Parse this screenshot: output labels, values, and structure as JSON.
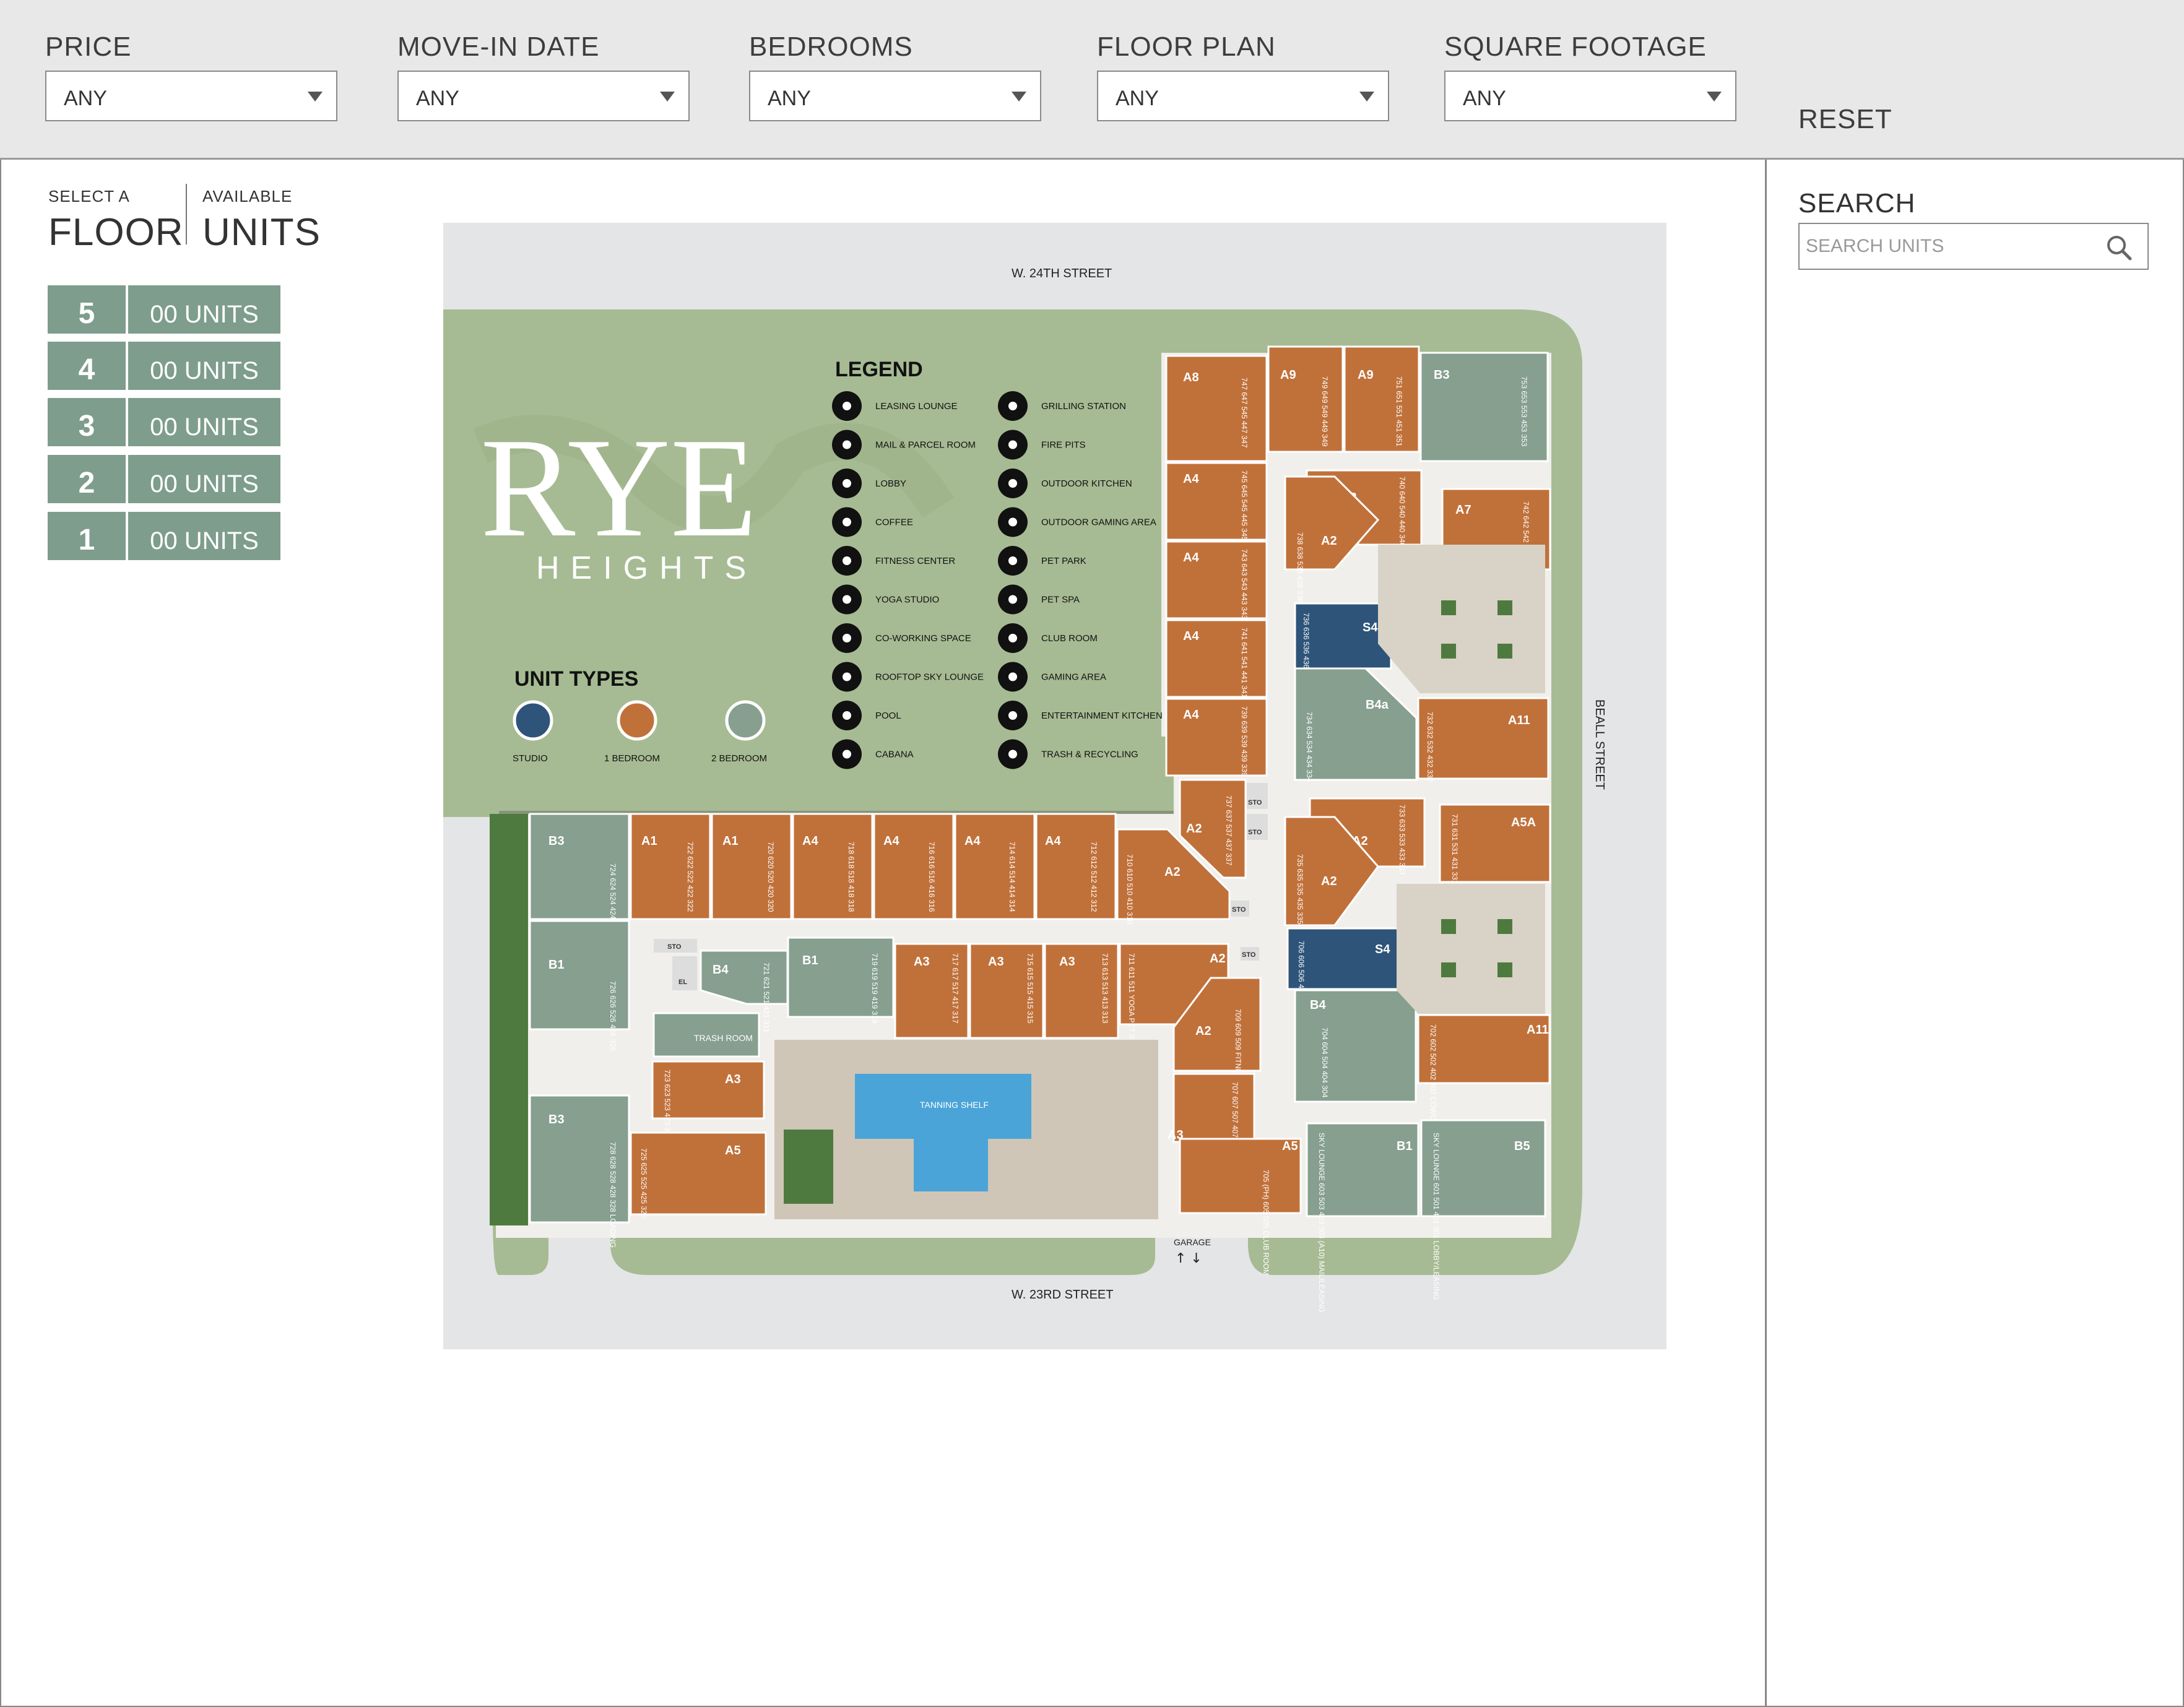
{
  "filters": [
    {
      "label": "PRICE",
      "value": "ANY"
    },
    {
      "label": "MOVE-IN DATE",
      "value": "ANY"
    },
    {
      "label": "BEDROOMS",
      "value": "ANY"
    },
    {
      "label": "FLOOR PLAN",
      "value": "ANY"
    },
    {
      "label": "SQUARE FOOTAGE",
      "value": "ANY"
    }
  ],
  "reset_label": "RESET",
  "floor_panel": {
    "select_a": "SELECT A",
    "floor": "FLOOR",
    "available": "AVAILABLE",
    "units": "UNITS",
    "floors": [
      {
        "number": "5",
        "units": "00 UNITS"
      },
      {
        "number": "4",
        "units": "00 UNITS"
      },
      {
        "number": "3",
        "units": "00 UNITS"
      },
      {
        "number": "2",
        "units": "00 UNITS"
      },
      {
        "number": "1",
        "units": "00 UNITS"
      }
    ]
  },
  "search": {
    "label": "SEARCH",
    "placeholder": "SEARCH UNITS"
  },
  "map": {
    "streets": {
      "north": "W. 24TH STREET",
      "south": "W. 23RD STREET",
      "east": "BEALL STREET"
    },
    "logo": {
      "main": "RYE",
      "sub": "HEIGHTS"
    },
    "legend_title": "LEGEND",
    "legend_left": [
      "LEASING LOUNGE",
      "MAIL & PARCEL ROOM",
      "LOBBY",
      "COFFEE",
      "FITNESS CENTER",
      "YOGA STUDIO",
      "CO-WORKING SPACE",
      "ROOFTOP SKY LOUNGE",
      "POOL",
      "CABANA"
    ],
    "legend_right": [
      "GRILLING STATION",
      "FIRE PITS",
      "OUTDOOR KITCHEN",
      "OUTDOOR GAMING AREA",
      "PET PARK",
      "PET SPA",
      "CLUB ROOM",
      "GAMING AREA",
      "ENTERTAINMENT KITCHEN",
      "TRASH & RECYCLING"
    ],
    "unit_types_title": "UNIT TYPES",
    "unit_types": [
      {
        "label": "STUDIO",
        "color": "#2e5479"
      },
      {
        "label": "1 BEDROOM",
        "color": "#c0713a"
      },
      {
        "label": "2 BEDROOM",
        "color": "#869f8f"
      }
    ],
    "top_row": [
      {
        "type": "A8",
        "nums": "747 647 545 447 347"
      },
      {
        "type": "A9",
        "nums": "749 649 549 449 349"
      },
      {
        "type": "A9",
        "nums": "751 651 551 451 351"
      },
      {
        "type": "B3",
        "nums": "753 653 553 453 353"
      }
    ],
    "east_col": [
      {
        "type": "A4",
        "nums": "745 645 545 445 345"
      },
      {
        "type": "A4",
        "nums": "743 643 543 443 343"
      },
      {
        "type": "A4",
        "nums": "741 641 541 441 341"
      },
      {
        "type": "A4",
        "nums": "739 639 539 439 339"
      },
      {
        "type": "A2",
        "nums": "737 637 537 437 337"
      }
    ],
    "north_row": [
      {
        "type": "B3",
        "nums": "724 624 524 424 324"
      },
      {
        "type": "A1",
        "nums": "722 622 522 422 322"
      },
      {
        "type": "A1",
        "nums": "720 620 520 420 320"
      },
      {
        "type": "A4",
        "nums": "718 618 518 418 318"
      },
      {
        "type": "A4",
        "nums": "716 616 516 416 316"
      },
      {
        "type": "A4",
        "nums": "714 614 514 414 314"
      },
      {
        "type": "A4",
        "nums": "712 612 512 412 312"
      },
      {
        "type": "A2",
        "nums": "710 610 510 410 310"
      }
    ],
    "inner_row": [
      {
        "type": "B4",
        "nums": "721 621 521 421 321"
      },
      {
        "type": "B1",
        "nums": "719 619 519 419 319"
      },
      {
        "type": "A3",
        "nums": "717 617 517 417 317"
      },
      {
        "type": "A3",
        "nums": "715 615 515 415 315"
      },
      {
        "type": "A3",
        "nums": "713 613 513 413 313"
      },
      {
        "type": "A2",
        "nums": "711 611 511 YOGA PET SPA"
      }
    ],
    "right_block": [
      {
        "type": "A2",
        "nums": "740 640 540 440 340"
      },
      {
        "type": "A7",
        "nums": "742 642 542 442 342"
      },
      {
        "type": "A2",
        "nums": "738 638 538 438 338"
      },
      {
        "type": "S4",
        "nums": "736 636 536 436 336 (S3)"
      },
      {
        "type": "B4a",
        "nums": "734 634 534 434 334"
      },
      {
        "type": "A11",
        "nums": "732 632 532 432 332"
      },
      {
        "type": "A2",
        "nums": "733 633 533 433 333"
      },
      {
        "type": "A5A",
        "nums": "731 631 531 431 331 (A7)"
      },
      {
        "type": "A2",
        "nums": "735 635 535 435 335"
      },
      {
        "type": "S4",
        "nums": "706 606 506 406 306 (S3)"
      },
      {
        "type": "B4",
        "nums": "704 604 504 404 304"
      },
      {
        "type": "A11",
        "nums": "702 602 502 402 302 COWORK/COFFEE"
      }
    ],
    "west_col": [
      {
        "type": "B1",
        "nums": "726 626 526 426 326"
      },
      {
        "type": "B3",
        "nums": "728 628 528 428 328 LOADING"
      },
      {
        "type": "A3",
        "nums": "723 623 523 423 323 (S1)"
      },
      {
        "type": "A5",
        "nums": "725 625 525 425 325"
      }
    ],
    "south_row": [
      {
        "type": "A2",
        "nums": "709 609 509 FITNESS"
      },
      {
        "type": "A3",
        "nums": "707 607 507 407 FITNESS"
      },
      {
        "type": "A5",
        "nums": "705 (PH) 605 505 CLUB ROOM"
      },
      {
        "type": "B1",
        "nums": "SKY LOUNGE 603 503 403 303 (A10) MAIL/LEASING"
      },
      {
        "type": "B5",
        "nums": "SKY LOUNGE 601 501 401 301 LOBBY/LEASING"
      }
    ],
    "labels": {
      "trash": "TRASH ROOM",
      "tanning": "TANNING SHELF",
      "garage": "GARAGE",
      "sto": "STO",
      "el": "EL"
    }
  }
}
